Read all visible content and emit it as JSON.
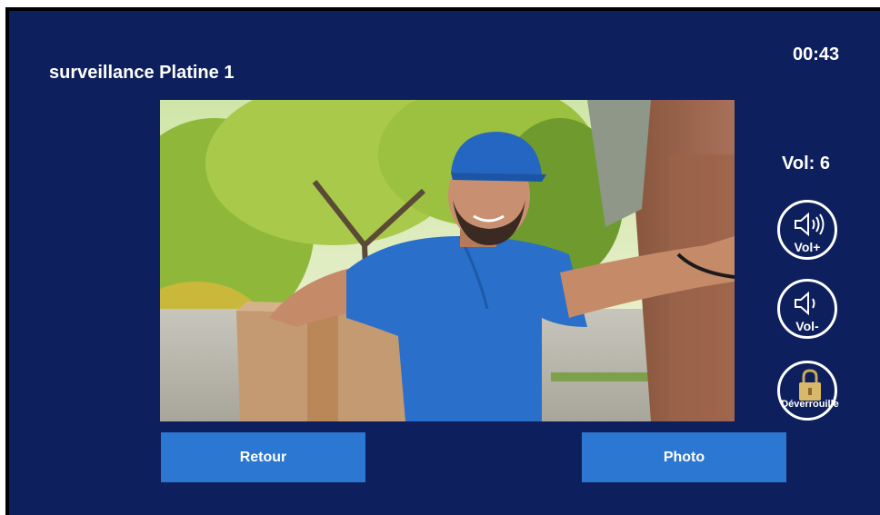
{
  "header": {
    "title": "surveillance Platine 1",
    "clock": "00:43"
  },
  "camera": {
    "feed_icon": "camera-feed-image"
  },
  "volume": {
    "label": "Vol: 6",
    "up_label": "Vol+",
    "up_icon": "speaker-loud-icon",
    "down_label": "Vol-",
    "down_icon": "speaker-quiet-icon"
  },
  "lock": {
    "label": "Déverrouille",
    "icon": "padlock-icon"
  },
  "actions": {
    "back_label": "Retour",
    "photo_label": "Photo"
  },
  "colors": {
    "background": "#0d1f5c",
    "button": "#2c77d1",
    "text": "#ffffff",
    "lock": "#d9b86a"
  }
}
